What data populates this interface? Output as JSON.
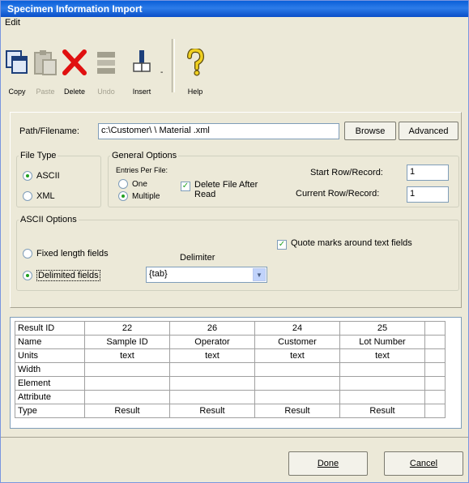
{
  "window": {
    "title": "Specimen Information Import"
  },
  "menu": {
    "edit": "Edit"
  },
  "toolbar": {
    "copy": "Copy",
    "paste": "Paste",
    "delete": "Delete",
    "undo": "Undo",
    "insert": "Insert",
    "help": "Help"
  },
  "path": {
    "label": "Path/Filename:",
    "value": "c:\\Customer\\ \\ Material   .xml",
    "browse": "Browse",
    "advanced": "Advanced"
  },
  "file_type": {
    "legend": "File Type",
    "ascii": "ASCII",
    "xml": "XML",
    "selected": "ASCII"
  },
  "general_options": {
    "legend": "General Options",
    "entries_per_file": "Entries Per File:",
    "one": "One",
    "multiple": "Multiple",
    "selected": "Multiple",
    "delete_after_read": "Delete File After Read",
    "delete_after_read_checked": true,
    "start_row_label": "Start Row/Record:",
    "start_row_value": "1",
    "current_row_label": "Current Row/Record:",
    "current_row_value": "1"
  },
  "ascii_options": {
    "legend": "ASCII Options",
    "fixed": "Fixed length fields",
    "delimited": "Delimited fields",
    "selected": "Delimited fields",
    "delimiter_label": "Delimiter",
    "delimiter_value": "{tab}",
    "quote_marks": "Quote marks around text fields",
    "quote_marks_checked": true
  },
  "grid": {
    "row_headers": [
      "Result ID",
      "Name",
      "Units",
      "Width",
      "Element",
      "Attribute",
      "Type"
    ],
    "columns": [
      {
        "result_id": "22",
        "name": "Sample ID",
        "units": "text",
        "width": "",
        "element": "",
        "attribute": "",
        "type": "Result"
      },
      {
        "result_id": "26",
        "name": "Operator",
        "units": "text",
        "width": "",
        "element": "",
        "attribute": "",
        "type": "Result"
      },
      {
        "result_id": "24",
        "name": "Customer",
        "units": "text",
        "width": "",
        "element": "",
        "attribute": "",
        "type": "Result"
      },
      {
        "result_id": "25",
        "name": "Lot Number",
        "units": "text",
        "width": "",
        "element": "",
        "attribute": "",
        "type": "Result"
      }
    ]
  },
  "buttons": {
    "done": "Done",
    "cancel": "Cancel"
  },
  "colors": {
    "title_bar": "#0a5fd8",
    "face": "#ece9d8",
    "delete_red": "#e01010",
    "help_yellow": "#f0d020"
  }
}
